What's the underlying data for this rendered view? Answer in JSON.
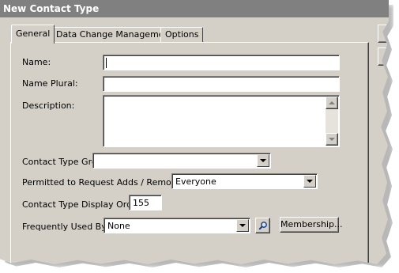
{
  "window": {
    "title": "New Contact Type"
  },
  "tabs": [
    {
      "label": "General",
      "active": true
    },
    {
      "label": "Data Change Management",
      "active": false
    },
    {
      "label": "Options",
      "active": false
    }
  ],
  "form": {
    "name": {
      "label": "Name:",
      "value": ""
    },
    "name_plural": {
      "label": "Name Plural:",
      "value": ""
    },
    "description": {
      "label": "Description:",
      "value": ""
    },
    "contact_type_group": {
      "label": "Contact Type Group:",
      "value": ""
    },
    "permitted": {
      "label": "Permitted to Request Adds / Removes:",
      "value": "Everyone"
    },
    "display_order": {
      "label": "Contact Type Display Order:",
      "value": "155"
    },
    "frequently_used_by": {
      "label": "Frequently Used By:",
      "value": "None"
    },
    "membership_button": "Membership..."
  },
  "icons": {
    "lookup": "magnifier-icon",
    "dropdown": "chevron-down-icon"
  },
  "colors": {
    "titlebar": "#808080",
    "face": "#d4d0c8",
    "field": "#ffffff"
  }
}
